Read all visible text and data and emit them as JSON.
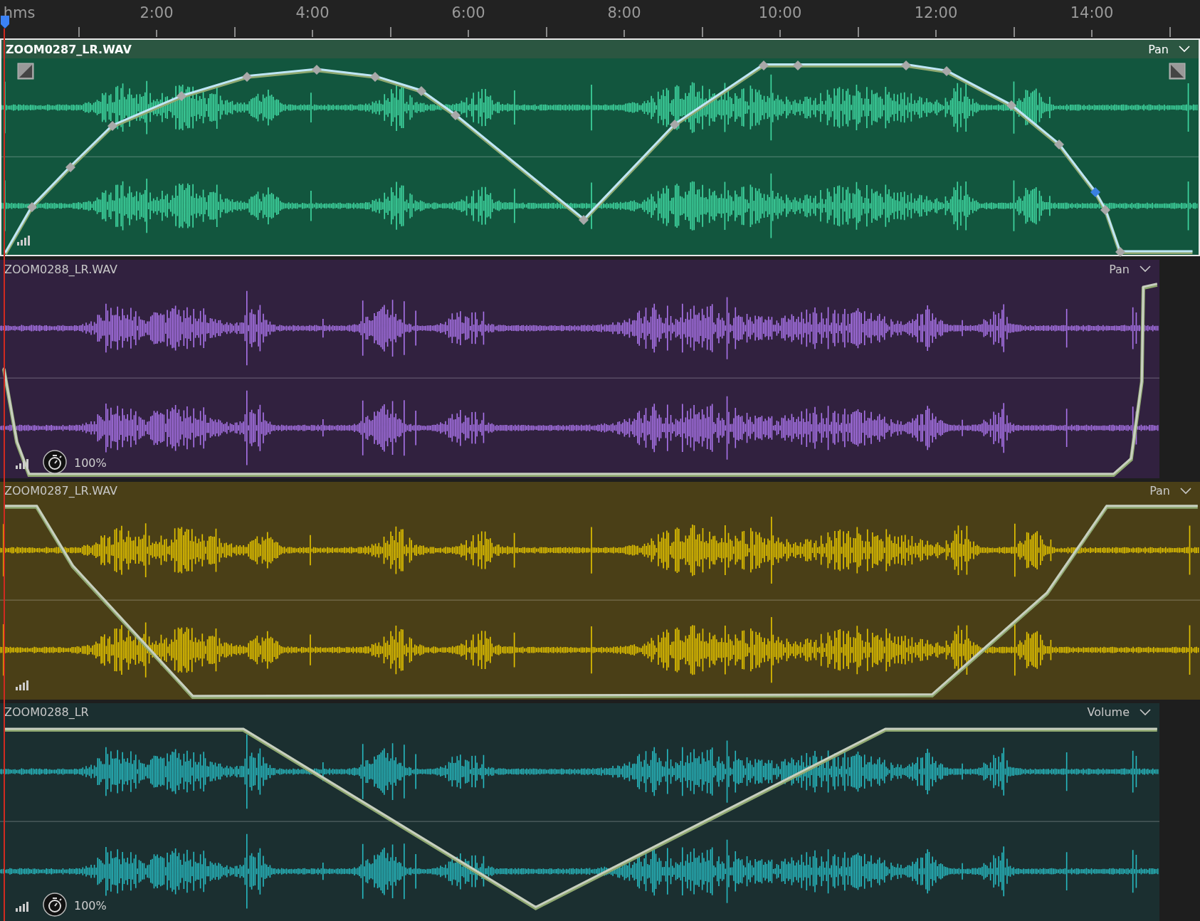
{
  "ruler": {
    "unit": "hms",
    "labels": [
      "2:00",
      "4:00",
      "6:00",
      "8:00",
      "10:00",
      "12:00",
      "14:00"
    ]
  },
  "clips": [
    {
      "name": "ZOOM0287_LR.WAV",
      "parameter": "Pan",
      "selected": true,
      "color": "#3fd6a0"
    },
    {
      "name": "ZOOM0288_LR.WAV",
      "parameter": "Pan",
      "selected": false,
      "color": "#a873e8",
      "speed": "100%"
    },
    {
      "name": "ZOOM0287_LR.WAV",
      "parameter": "Pan",
      "selected": false,
      "color": "#e0c000"
    },
    {
      "name": "ZOOM0288_LR",
      "parameter": "Volume",
      "selected": false,
      "color": "#27b8bf",
      "speed": "100%"
    }
  ]
}
